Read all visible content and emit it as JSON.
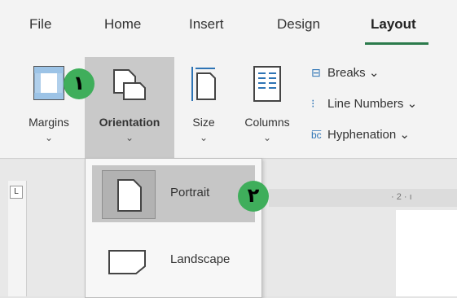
{
  "tabs": [
    "File",
    "Home",
    "Insert",
    "Design",
    "Layout"
  ],
  "ribbon": {
    "margins": {
      "label": "Margins",
      "chevron": "⌄"
    },
    "orientation": {
      "label": "Orientation",
      "chevron": "⌄"
    },
    "size": {
      "label": "Size",
      "chevron": "⌄"
    },
    "columns": {
      "label": "Columns",
      "chevron": "⌄"
    },
    "breaks": {
      "label": "Breaks",
      "chevron": "⌄",
      "icon": "breaks-icon"
    },
    "line_numbers": {
      "label": "Line Numbers",
      "chevron": "⌄",
      "icon": "line-numbers-icon"
    },
    "hyphenation": {
      "label": "Hyphenation",
      "chevron": "⌄",
      "icon": "hyphenation-icon"
    }
  },
  "badges": [
    "۱",
    "۲"
  ],
  "orientation_menu": {
    "items": [
      {
        "label": "Portrait",
        "icon": "portrait-page-icon",
        "selected": true
      },
      {
        "label": "Landscape",
        "icon": "landscape-page-icon",
        "selected": false
      }
    ]
  },
  "ruler": {
    "corner": "L",
    "top_marks": "· 2 · ı"
  },
  "colors": {
    "accent": "#2b7a4b",
    "badge": "#3fae5b",
    "icon_blue": "#2e74b5"
  }
}
